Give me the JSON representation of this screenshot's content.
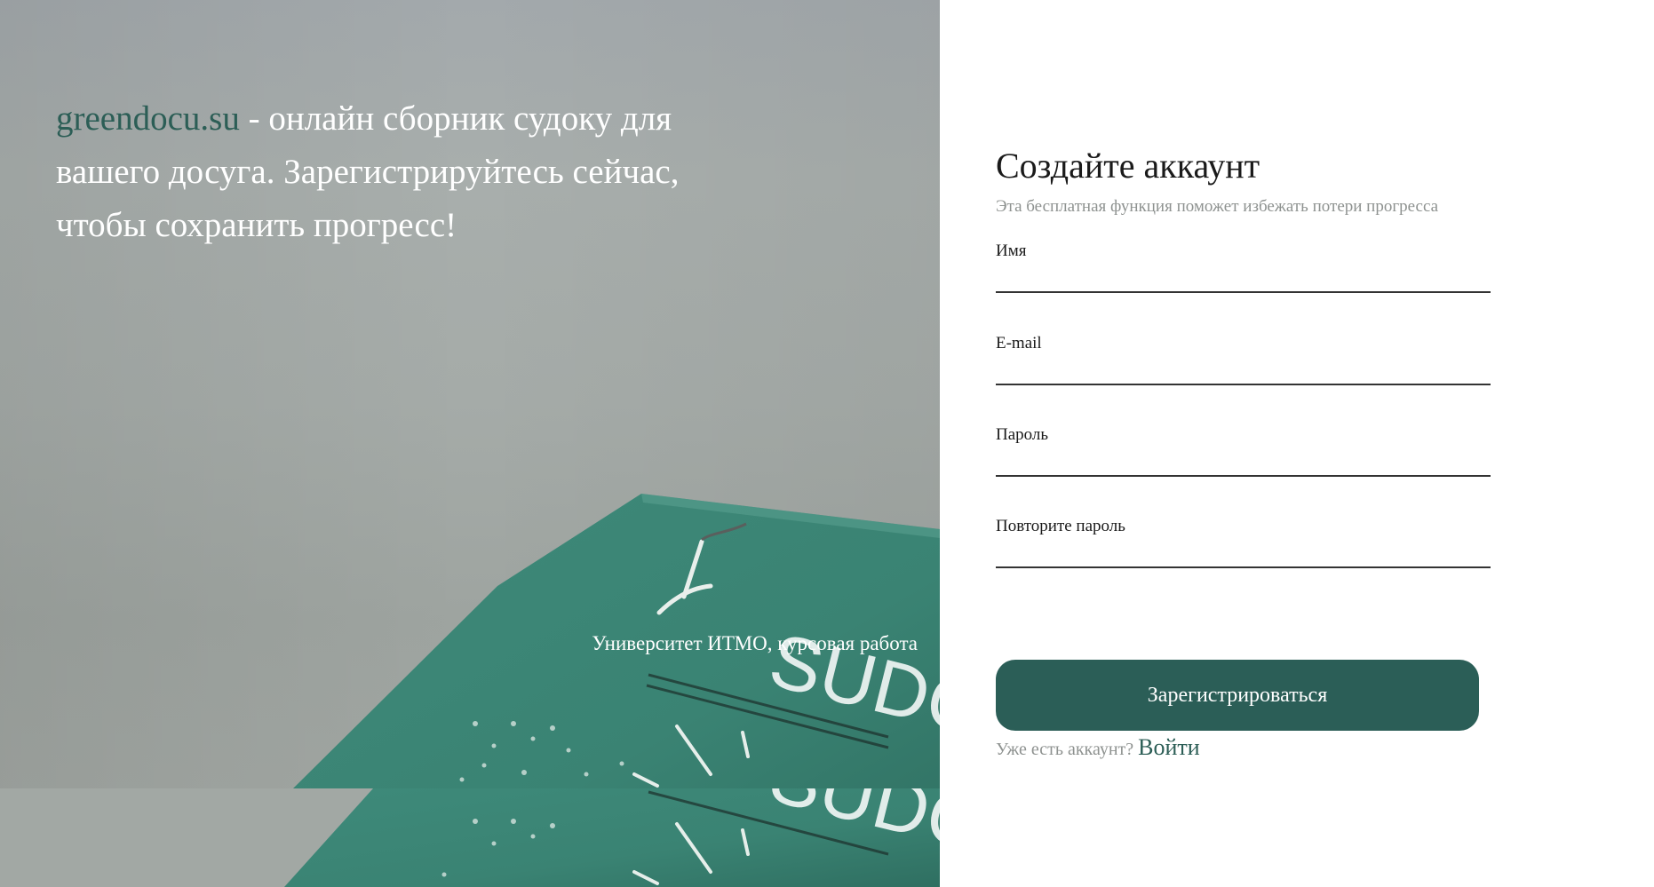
{
  "hero": {
    "brand": "greendocu.su",
    "tagline": " - онлайн сборник судоку для вашего досуга. Зарегистрируйтесь сейчас, чтобы сохранить прогресс!",
    "caption": "Университет ИТМО, курсовая работа",
    "image_text": "SUDO"
  },
  "form": {
    "title": "Создайте аккаунт",
    "subtitle": "Эта бесплатная функция поможет избежать потери прогресса",
    "fields": [
      {
        "label": "Имя",
        "value": ""
      },
      {
        "label": "E-mail",
        "value": ""
      },
      {
        "label": "Пароль",
        "value": ""
      },
      {
        "label": "Повторите пароль",
        "value": ""
      }
    ],
    "submit_label": "Зарегистрироваться",
    "login_question": "Уже есть аккаунт? ",
    "login_link": "Войти"
  },
  "colors": {
    "accent": "#2b5e57",
    "muted_text": "#8e9290",
    "book_green": "#3f8a7a"
  }
}
